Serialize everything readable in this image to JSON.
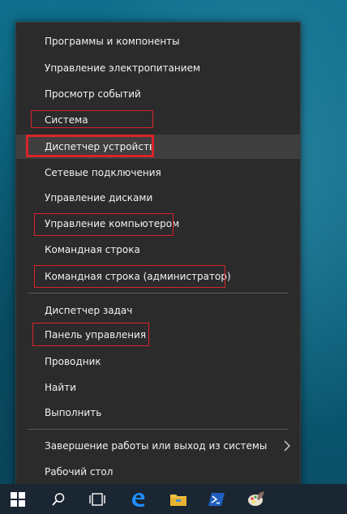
{
  "menu": {
    "items": [
      {
        "label": "Программы и компоненты"
      },
      {
        "label": "Управление электропитанием"
      },
      {
        "label": "Просмотр событий"
      },
      {
        "label": "Система"
      },
      {
        "label": "Диспетчер устройств"
      },
      {
        "label": "Сетевые подключения"
      },
      {
        "label": "Управление дисками"
      },
      {
        "label": "Управление компьютером"
      },
      {
        "label": "Командная строка"
      },
      {
        "label": "Командная строка (администратор)"
      },
      {
        "label": "Диспетчер задач"
      },
      {
        "label": "Панель управления"
      },
      {
        "label": "Проводник"
      },
      {
        "label": "Найти"
      },
      {
        "label": "Выполнить"
      },
      {
        "label": "Завершение работы или выход из системы"
      },
      {
        "label": "Рабочий стол"
      }
    ],
    "selected_item": "Диспетчер устройств"
  },
  "taskbar": {
    "icons": [
      "windows-start-icon",
      "search-icon",
      "task-view-icon",
      "edge-icon",
      "file-explorer-icon",
      "powershell-icon",
      "paint-icon"
    ]
  },
  "colors": {
    "menu_bg": "#2b2b2b",
    "highlight_red": "#d9242b",
    "taskbar_bg": "#1b2633",
    "desktop": "#0f6f8c"
  }
}
